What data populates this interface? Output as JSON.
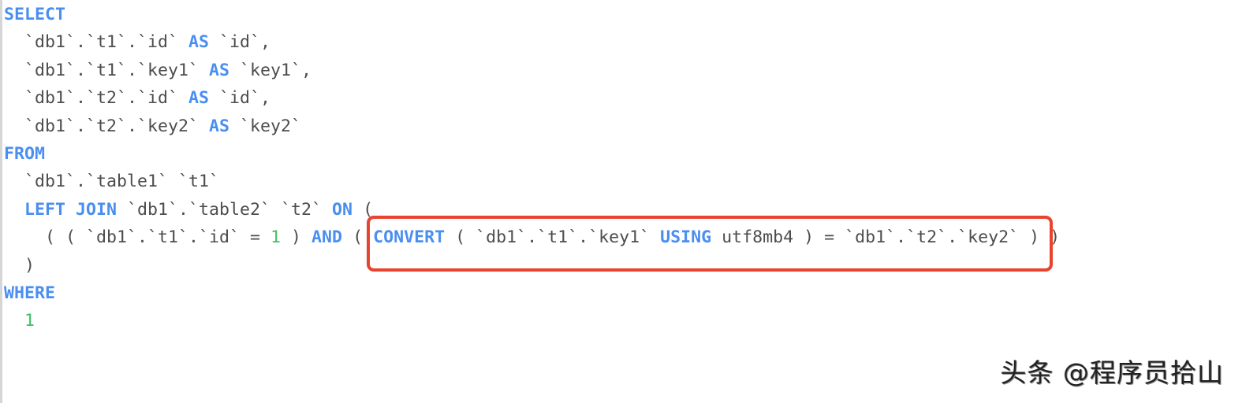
{
  "editor": {
    "language": "sql",
    "colors": {
      "keyword": "#4a8ff0",
      "identifier": "#4d4d4d",
      "number": "#3fbf5f",
      "highlight_border": "#e8432e"
    },
    "lines": [
      [
        {
          "t": "kw",
          "v": "SELECT"
        }
      ],
      [
        {
          "t": "id",
          "v": "  `db1`.`t1`.`id` "
        },
        {
          "t": "kw",
          "v": "AS"
        },
        {
          "t": "id",
          "v": " `id`,"
        }
      ],
      [
        {
          "t": "id",
          "v": "  `db1`.`t1`.`key1` "
        },
        {
          "t": "kw",
          "v": "AS"
        },
        {
          "t": "id",
          "v": " `key1`,"
        }
      ],
      [
        {
          "t": "id",
          "v": "  `db1`.`t2`.`id` "
        },
        {
          "t": "kw",
          "v": "AS"
        },
        {
          "t": "id",
          "v": " `id`,"
        }
      ],
      [
        {
          "t": "id",
          "v": "  `db1`.`t2`.`key2` "
        },
        {
          "t": "kw",
          "v": "AS"
        },
        {
          "t": "id",
          "v": " `key2`"
        }
      ],
      [
        {
          "t": "kw",
          "v": "FROM"
        }
      ],
      [
        {
          "t": "id",
          "v": "  `db1`.`table1` `t1`"
        }
      ],
      [
        {
          "t": "id",
          "v": "  "
        },
        {
          "t": "kw",
          "v": "LEFT JOIN"
        },
        {
          "t": "id",
          "v": " `db1`.`table2` `t2` "
        },
        {
          "t": "kw",
          "v": "ON"
        },
        {
          "t": "id",
          "v": " ("
        }
      ],
      [
        {
          "t": "id",
          "v": "    ( ( `db1`.`t1`.`id` = "
        },
        {
          "t": "num",
          "v": "1"
        },
        {
          "t": "id",
          "v": " ) "
        },
        {
          "t": "kw",
          "v": "AND"
        },
        {
          "t": "id",
          "v": " ( "
        },
        {
          "t": "kw",
          "v": "CONVERT"
        },
        {
          "t": "id",
          "v": " ( `db1`.`t1`.`key1` "
        },
        {
          "t": "kw",
          "v": "USING"
        },
        {
          "t": "id",
          "v": " utf8mb4 ) = `db1`.`t2`.`key2` ) )"
        }
      ],
      [
        {
          "t": "id",
          "v": "  )"
        }
      ],
      [
        {
          "t": "kw",
          "v": "WHERE"
        }
      ],
      [
        {
          "t": "id",
          "v": "  "
        },
        {
          "t": "num",
          "v": "1"
        }
      ]
    ],
    "highlighted_expression": "CONVERT ( `db1`.`t1`.`key1` USING utf8mb4 ) = `db1`.`t2`.`key2` )"
  },
  "watermark": {
    "text": "头条 @程序员拾山"
  }
}
